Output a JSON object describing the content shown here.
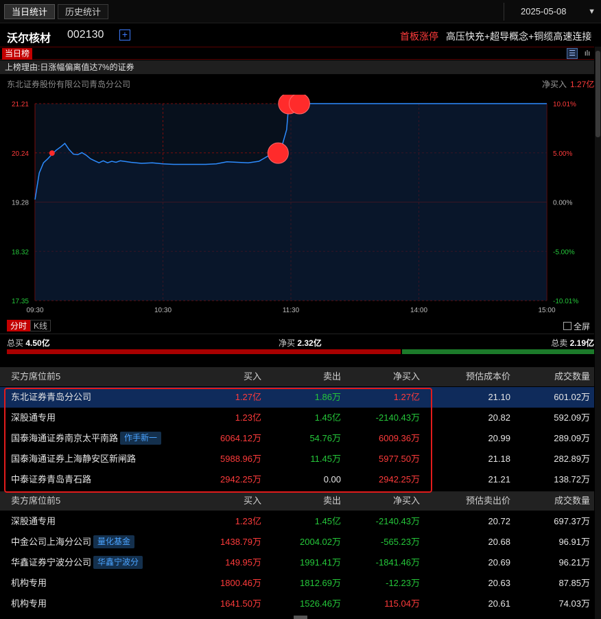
{
  "tabs": [
    "当日统计",
    "历史统计"
  ],
  "date": "2025-05-08",
  "stock": {
    "name": "沃尔核材",
    "code": "002130",
    "limit_tag": "首板涨停",
    "concept": "高压快充+超导概念+铜缆高速连接"
  },
  "list_tag": "当日榜",
  "reason": "上榜理由:日涨幅偏离值达7%的证券",
  "branch_name": "东北证券股份有限公司青岛分公司",
  "net_buy_label": "净买入",
  "net_buy_value": "1.27亿",
  "chart_data": {
    "type": "line",
    "x_ticks": [
      "09:30",
      "10:30",
      "11:30",
      "14:00",
      "15:00"
    ],
    "y_left_ticks": [
      "21.21",
      "20.24",
      "19.28",
      "18.32",
      "17.35"
    ],
    "y_right_ticks": [
      "10.01%",
      "5.00%",
      "0.00%",
      "-5.00%",
      "-10.01%"
    ],
    "ylim": [
      17.35,
      21.21
    ],
    "prev_close": 19.28,
    "series": [
      {
        "x": [
          0,
          2,
          4,
          6,
          8,
          10,
          12,
          14,
          16,
          18,
          20,
          22,
          24,
          26,
          28,
          30,
          32,
          34,
          36,
          38,
          40,
          45,
          50,
          55,
          60,
          65,
          70,
          75,
          80,
          85,
          90,
          95,
          100,
          105,
          110,
          115,
          118,
          119,
          120,
          240
        ],
        "y": [
          19.33,
          19.85,
          20.05,
          20.13,
          20.22,
          20.3,
          20.36,
          20.43,
          20.31,
          20.22,
          20.21,
          20.25,
          20.2,
          20.13,
          20.09,
          20.05,
          20.09,
          20.05,
          20.08,
          20.06,
          20.09,
          20.06,
          20.04,
          20.05,
          20.03,
          20.02,
          20.02,
          20.02,
          20.02,
          20.03,
          20.07,
          20.06,
          20.05,
          20.08,
          20.2,
          20.26,
          20.7,
          21.21,
          21.21,
          21.21
        ]
      }
    ],
    "markers": [
      {
        "x": 8,
        "y": 20.24,
        "size": "small"
      },
      {
        "x": 114,
        "y": 20.24,
        "size": "large"
      },
      {
        "x": 119,
        "y": 21.21,
        "size": "large"
      },
      {
        "x": 124,
        "y": 21.21,
        "size": "large"
      }
    ]
  },
  "mode_tabs": [
    "分时",
    "K线"
  ],
  "fullscreen_label": "全屏",
  "totals": {
    "buy_label": "总买",
    "buy_value": "4.50亿",
    "net_label": "净买",
    "net_value": "2.32亿",
    "sell_label": "总卖",
    "sell_value": "2.19亿",
    "buy_ratio": 0.672
  },
  "buy_table": {
    "headers": [
      "买方席位前5",
      "买入",
      "卖出",
      "净买入",
      "预估成本价",
      "成交数量"
    ],
    "rows": [
      {
        "name": "东北证券青岛分公司",
        "badge": "",
        "buy": "1.27亿",
        "sell": "1.86万",
        "net": "1.27亿",
        "net_color": "red",
        "price": "21.10",
        "vol": "601.02万"
      },
      {
        "name": "深股通专用",
        "badge": "",
        "buy": "1.23亿",
        "sell": "1.45亿",
        "net": "-2140.43万",
        "net_color": "green",
        "price": "20.82",
        "vol": "592.09万"
      },
      {
        "name": "国泰海通证券南京太平南路",
        "badge": "作手新一",
        "buy": "6064.12万",
        "sell": "54.76万",
        "net": "6009.36万",
        "net_color": "red",
        "price": "20.99",
        "vol": "289.09万"
      },
      {
        "name": "国泰海通证券上海静安区新闸路",
        "badge": "",
        "buy": "5988.96万",
        "sell": "11.45万",
        "net": "5977.50万",
        "net_color": "red",
        "price": "21.18",
        "vol": "282.89万"
      },
      {
        "name": "中泰证券青岛青石路",
        "badge": "",
        "buy": "2942.25万",
        "sell": "0.00",
        "net": "2942.25万",
        "net_color": "red",
        "price": "21.21",
        "vol": "138.72万"
      }
    ]
  },
  "sell_table": {
    "headers": [
      "卖方席位前5",
      "买入",
      "卖出",
      "净买入",
      "预估卖出价",
      "成交数量"
    ],
    "rows": [
      {
        "name": "深股通专用",
        "badge": "",
        "buy": "1.23亿",
        "sell": "1.45亿",
        "net": "-2140.43万",
        "net_color": "green",
        "price": "20.72",
        "vol": "697.37万"
      },
      {
        "name": "中金公司上海分公司",
        "badge": "量化基金",
        "buy": "1438.79万",
        "sell": "2004.02万",
        "net": "-565.23万",
        "net_color": "green",
        "price": "20.68",
        "vol": "96.91万"
      },
      {
        "name": "华鑫证券宁波分公司",
        "badge": "华鑫宁波分",
        "buy": "149.95万",
        "sell": "1991.41万",
        "net": "-1841.46万",
        "net_color": "green",
        "price": "20.69",
        "vol": "96.21万"
      },
      {
        "name": "机构专用",
        "badge": "",
        "buy": "1800.46万",
        "sell": "1812.69万",
        "net": "-12.23万",
        "net_color": "green",
        "price": "20.63",
        "vol": "87.85万"
      },
      {
        "name": "机构专用",
        "badge": "",
        "buy": "1641.50万",
        "sell": "1526.46万",
        "net": "115.04万",
        "net_color": "red",
        "price": "20.61",
        "vol": "74.03万"
      }
    ]
  }
}
